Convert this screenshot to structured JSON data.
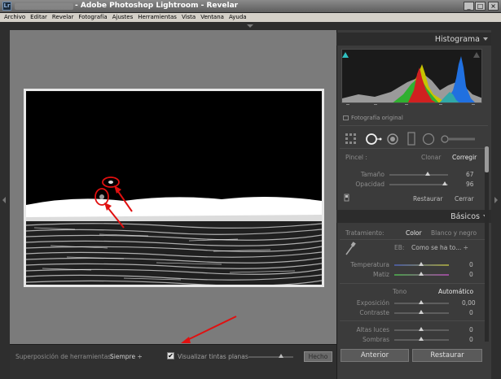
{
  "window": {
    "app_icon": "Lr",
    "title": "- Adobe Photoshop Lightroom - Revelar",
    "minimize": "_",
    "maximize": "□",
    "close": "×"
  },
  "menu": [
    "Archivo",
    "Editar",
    "Revelar",
    "Fotografía",
    "Ajustes",
    "Herramientas",
    "Vista",
    "Ventana",
    "Ayuda"
  ],
  "toolbar": {
    "overlay_label": "Superposición de herramientas:",
    "overlay_value": "Siempre ÷",
    "show_spots_checked": true,
    "check_mark": "✔",
    "show_spots_label": "Visualizar tintas planas",
    "done_label": "Hecho"
  },
  "histogram_panel": {
    "title": "Histograma",
    "original_label": "Fotografía original"
  },
  "pincel": {
    "label": "Pincel :",
    "clone": "Clonar",
    "heal": "Corregir",
    "size_label": "Tamaño",
    "size_value": "67",
    "size_fraction": 0.67,
    "opacity_label": "Opacidad",
    "opacity_value": "96",
    "opacity_fraction": 0.96,
    "reset": "Restaurar",
    "close": "Cerrar"
  },
  "basic_panel": {
    "title": "Básicos",
    "treatment_label": "Tratamiento:",
    "color": "Color",
    "bw": "Blanco y negro",
    "wb_label": "EB:",
    "wb_value": "Como se ha to... ÷",
    "temperature_label": "Temperatura",
    "temperature_value": "0",
    "tint_label": "Matiz",
    "tint_value": "0",
    "tone_label": "Tono",
    "auto_label": "Automático",
    "exposure_label": "Exposición",
    "exposure_value": "0,00",
    "contrast_label": "Contraste",
    "contrast_value": "0",
    "highlights_label": "Altas luces",
    "highlights_value": "0",
    "shadows_label": "Sombras",
    "shadows_value": "0"
  },
  "bottom_buttons": {
    "previous": "Anterior",
    "reset": "Restaurar"
  },
  "colors": {
    "annotation_red": "#e01010",
    "panel_bg": "#3b3b3b",
    "canvas_bg": "#7b7b7b"
  }
}
